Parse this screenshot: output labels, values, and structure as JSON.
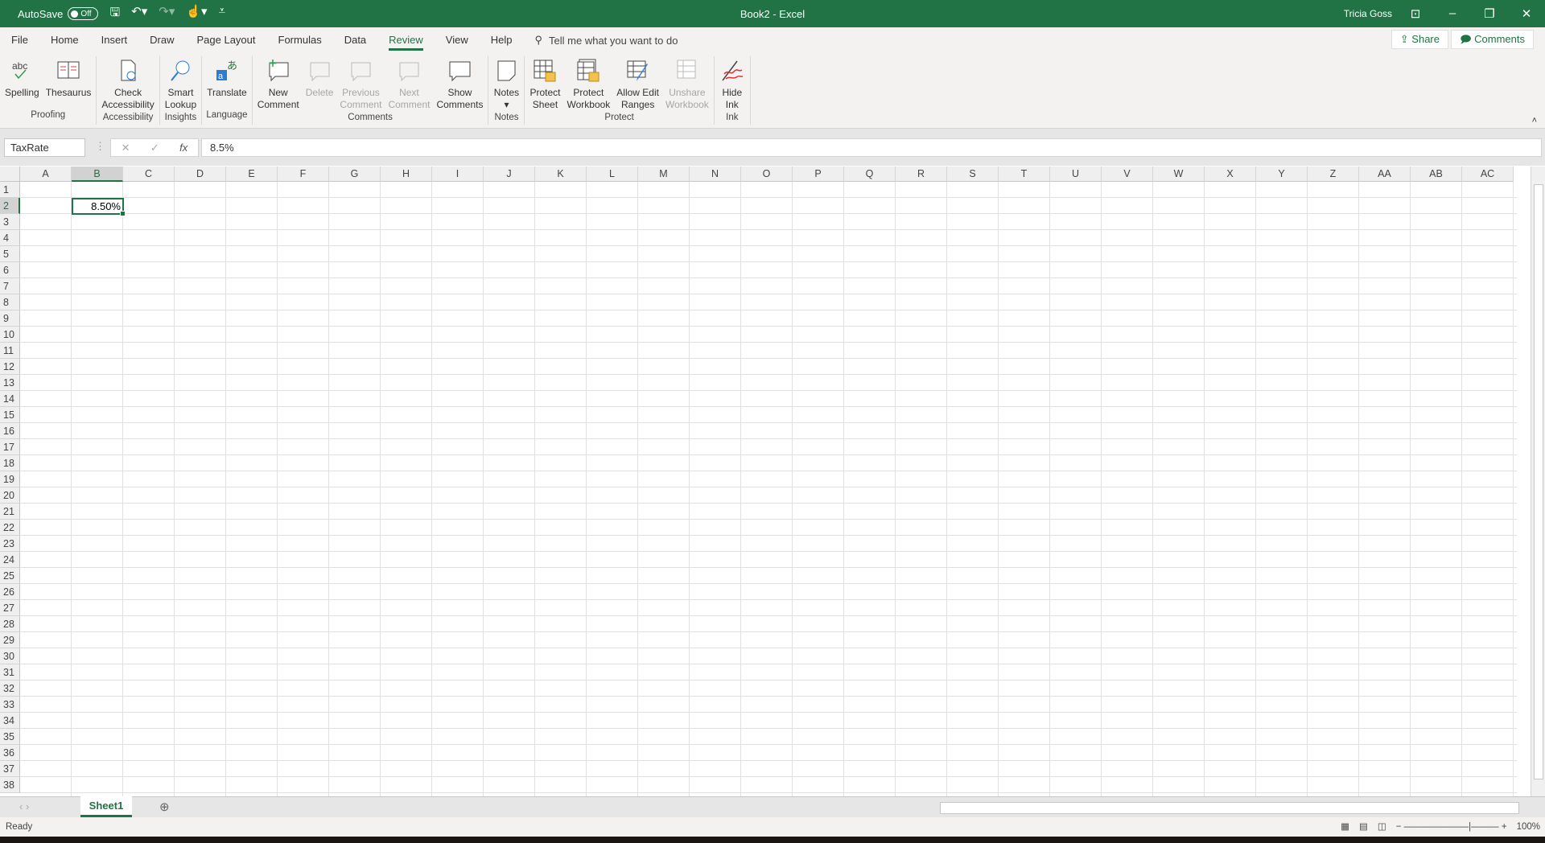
{
  "titlebar": {
    "autosave_label": "AutoSave",
    "autosave_state": "Off",
    "title": "Book2  -  Excel",
    "user": "Tricia Goss"
  },
  "menu": {
    "tabs": [
      "File",
      "Home",
      "Insert",
      "Draw",
      "Page Layout",
      "Formulas",
      "Data",
      "Review",
      "View",
      "Help"
    ],
    "active": "Review",
    "tell_me": "Tell me what you want to do",
    "share": "Share",
    "comments": "Comments"
  },
  "ribbon": {
    "groups": [
      {
        "name": "Proofing",
        "buttons": [
          {
            "label": "Spelling",
            "icon": "spelling-icon"
          },
          {
            "label": "Thesaurus",
            "icon": "thesaurus-icon"
          }
        ]
      },
      {
        "name": "Accessibility",
        "buttons": [
          {
            "label": "Check\nAccessibility",
            "icon": "accessibility-icon"
          }
        ]
      },
      {
        "name": "Insights",
        "buttons": [
          {
            "label": "Smart\nLookup",
            "icon": "smart-lookup-icon"
          }
        ]
      },
      {
        "name": "Language",
        "buttons": [
          {
            "label": "Translate",
            "icon": "translate-icon"
          }
        ]
      },
      {
        "name": "Comments",
        "buttons": [
          {
            "label": "New\nComment",
            "icon": "new-comment-icon"
          },
          {
            "label": "Delete",
            "icon": "delete-comment-icon",
            "disabled": true
          },
          {
            "label": "Previous\nComment",
            "icon": "previous-comment-icon",
            "disabled": true
          },
          {
            "label": "Next\nComment",
            "icon": "next-comment-icon",
            "disabled": true
          },
          {
            "label": "Show\nComments",
            "icon": "show-comments-icon"
          }
        ]
      },
      {
        "name": "Notes",
        "buttons": [
          {
            "label": "Notes\n▾",
            "icon": "notes-icon"
          }
        ]
      },
      {
        "name": "Protect",
        "buttons": [
          {
            "label": "Protect\nSheet",
            "icon": "protect-sheet-icon"
          },
          {
            "label": "Protect\nWorkbook",
            "icon": "protect-workbook-icon"
          },
          {
            "label": "Allow Edit\nRanges",
            "icon": "allow-edit-ranges-icon"
          },
          {
            "label": "Unshare\nWorkbook",
            "icon": "unshare-workbook-icon",
            "disabled": true
          }
        ]
      },
      {
        "name": "Ink",
        "buttons": [
          {
            "label": "Hide\nInk",
            "icon": "hide-ink-icon"
          }
        ]
      }
    ]
  },
  "formula_bar": {
    "name_box": "TaxRate",
    "formula": "8.5%"
  },
  "grid": {
    "columns": [
      "A",
      "B",
      "C",
      "D",
      "E",
      "F",
      "G",
      "H",
      "I",
      "J",
      "K",
      "L",
      "M",
      "N",
      "O",
      "P",
      "Q",
      "R",
      "S",
      "T",
      "U",
      "V",
      "W",
      "X",
      "Y",
      "Z",
      "AA",
      "AB",
      "AC"
    ],
    "row_count": 38,
    "selected_column": "B",
    "selected_row": 2,
    "cells": {
      "B2": "8.50%"
    }
  },
  "sheets": {
    "tabs": [
      "Sheet1"
    ],
    "active": "Sheet1"
  },
  "status": {
    "text": "Ready",
    "zoom": "100%"
  },
  "colors": {
    "accent": "#217346"
  }
}
